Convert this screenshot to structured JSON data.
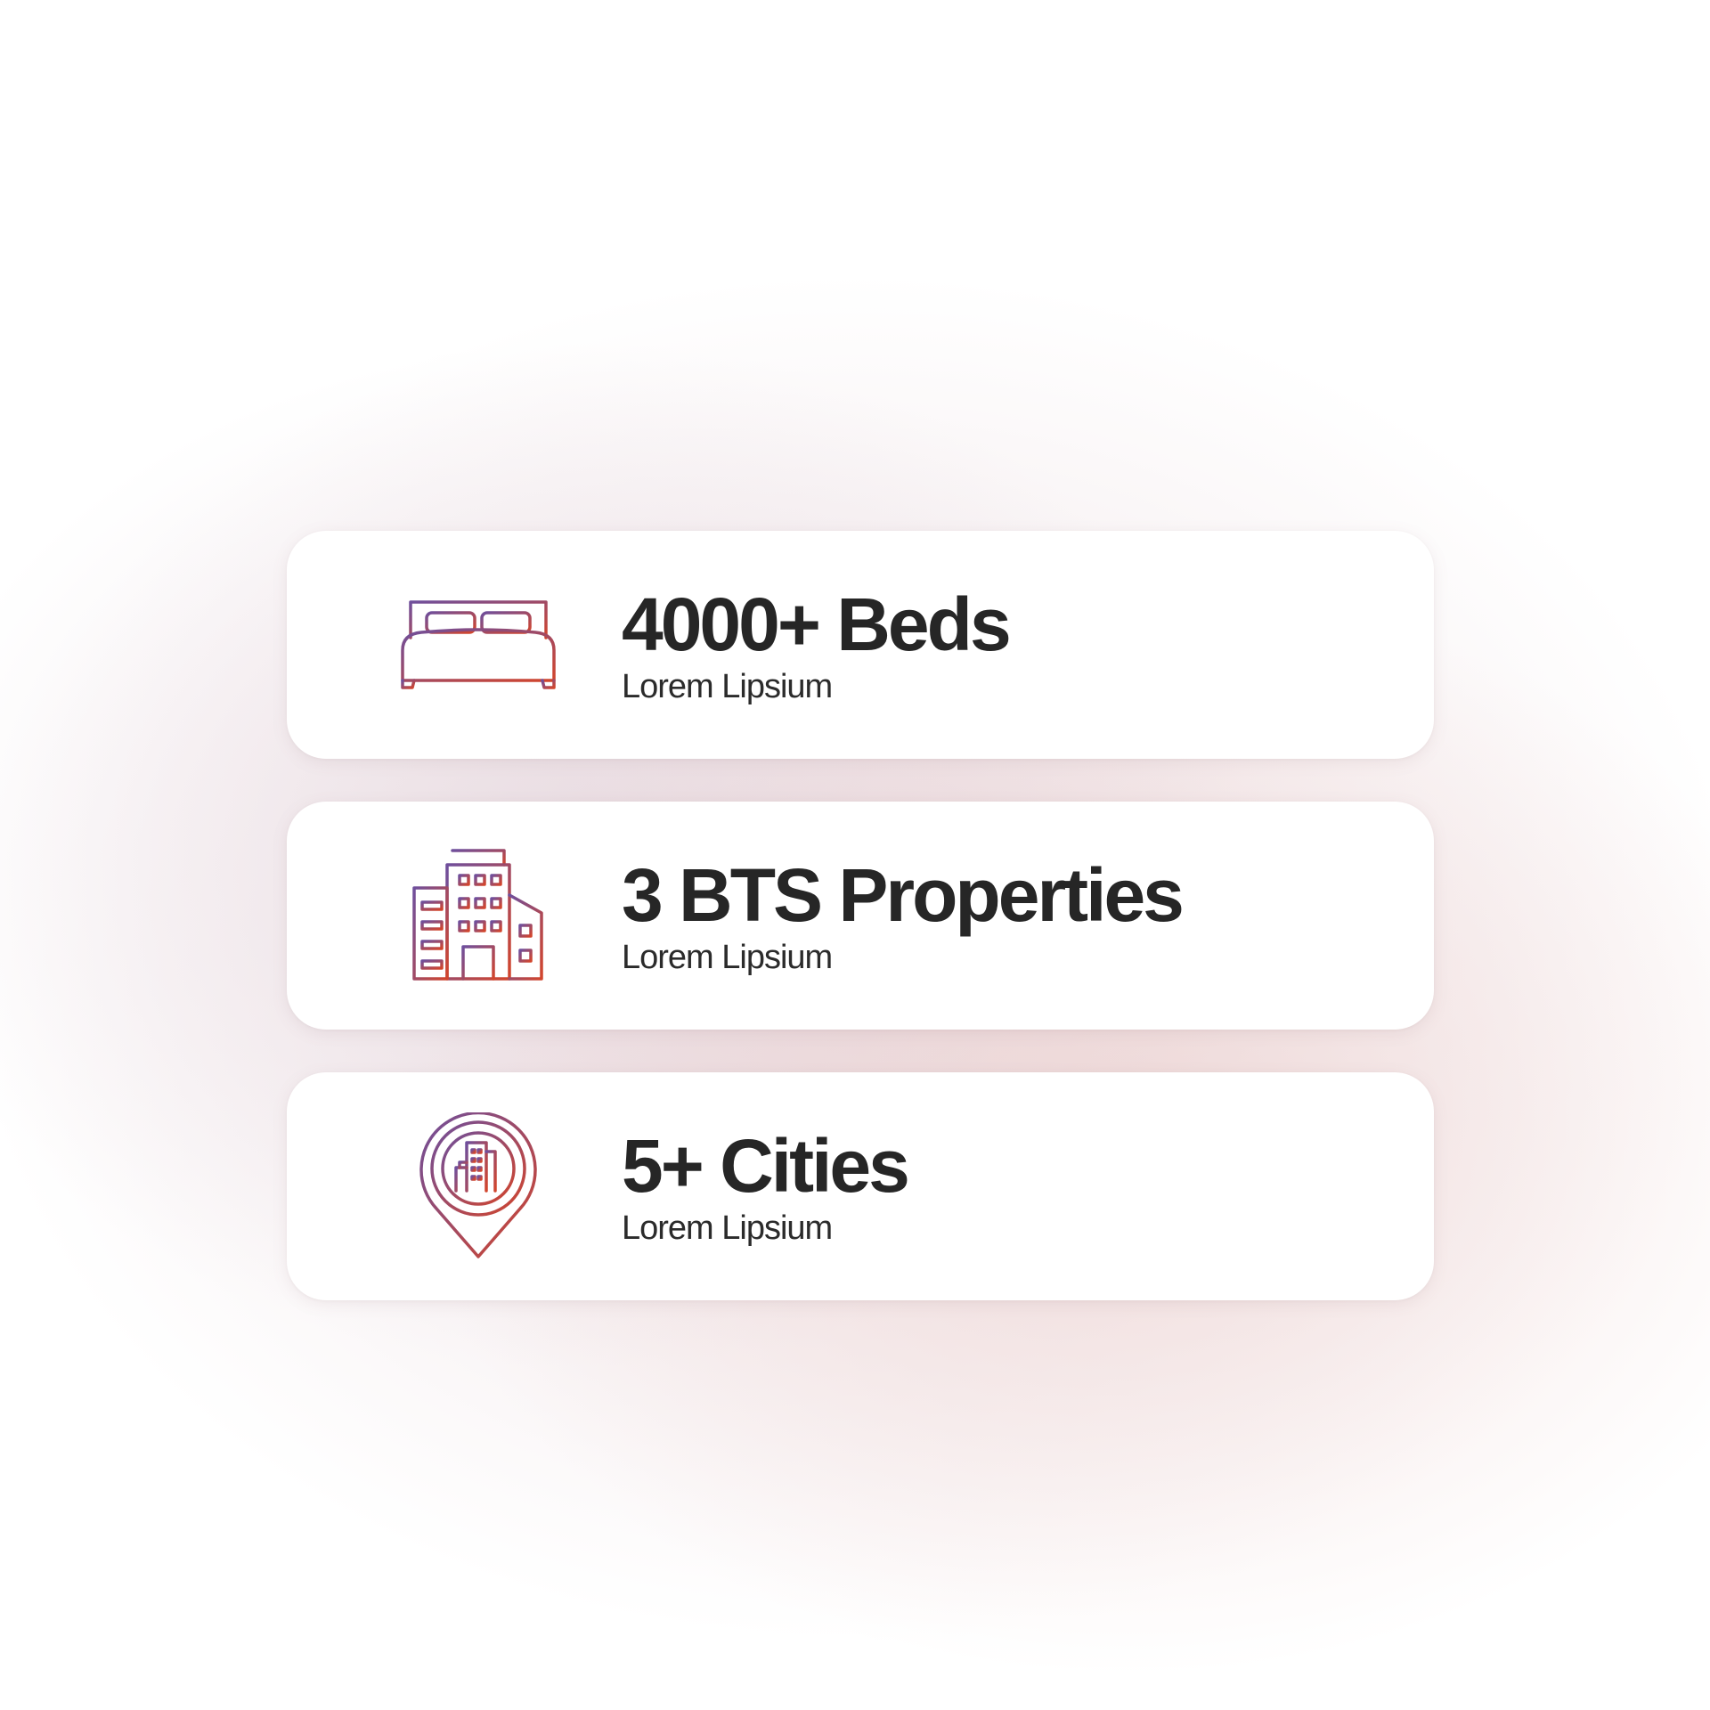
{
  "gradient": {
    "start": "#6f4f9c",
    "end": "#d2452c"
  },
  "text_color": "#262626",
  "stats": [
    {
      "icon": "bed-icon",
      "title": "4000+ Beds",
      "subtitle": "Lorem Lipsium"
    },
    {
      "icon": "buildings-icon",
      "title": "3 BTS Properties",
      "subtitle": "Lorem Lipsium"
    },
    {
      "icon": "city-location-pin-icon",
      "title": "5+ Cities",
      "subtitle": "Lorem Lipsium"
    }
  ]
}
